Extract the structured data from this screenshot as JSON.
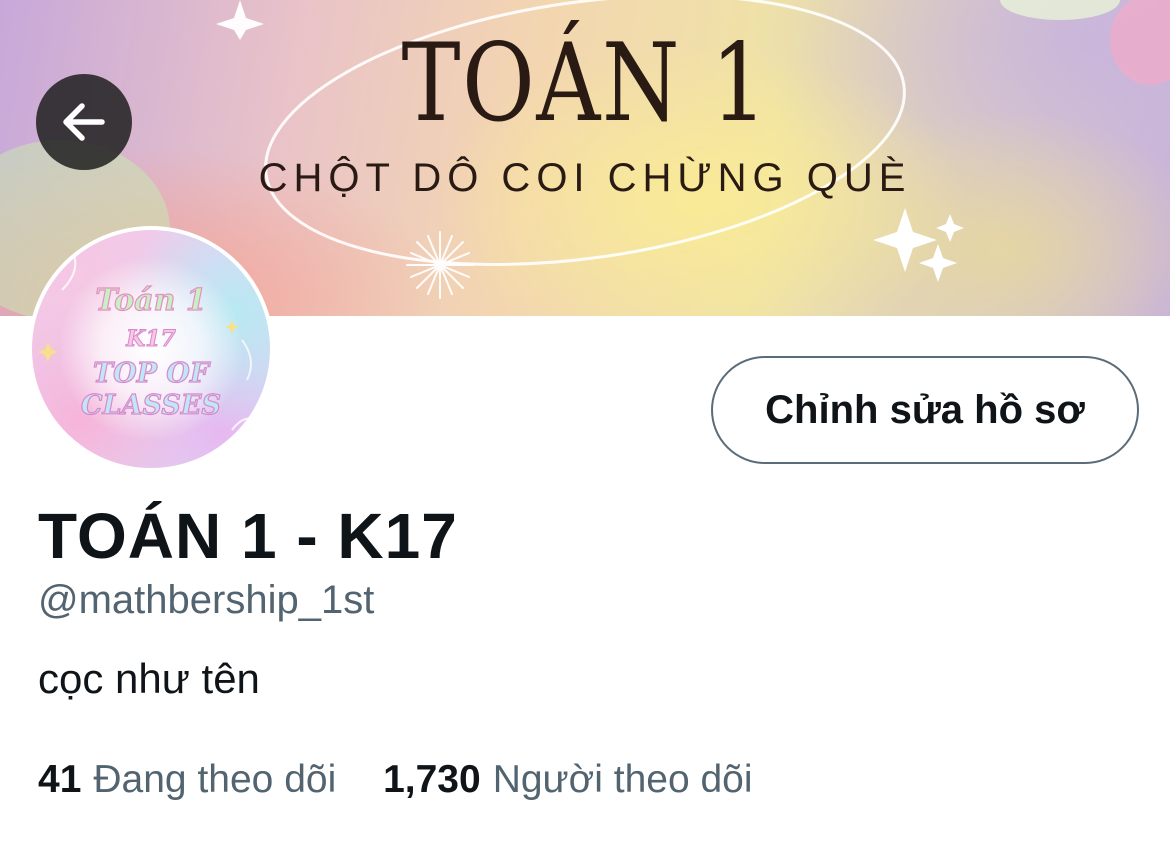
{
  "banner": {
    "title": "TOÁN 1",
    "subtitle": "CHỘT DÔ COI CHỪNG QUÈ"
  },
  "header": {
    "back_icon": "arrow-left-icon"
  },
  "avatar": {
    "lines": [
      "Toán 1",
      "K17",
      "TOP OF",
      "CLASSES"
    ]
  },
  "actions": {
    "edit_profile_label": "Chỉnh sửa hồ sơ"
  },
  "profile": {
    "display_name": "TOÁN 1 - K17",
    "handle": "@mathbership_1st",
    "bio": "cọc như tên"
  },
  "stats": {
    "following_count": "41",
    "following_label": "Đang theo dõi",
    "followers_count": "1,730",
    "followers_label": "Người theo dõi"
  },
  "colors": {
    "text_primary": "#0f1419",
    "text_secondary": "#536471",
    "button_border": "#5b6b78"
  }
}
